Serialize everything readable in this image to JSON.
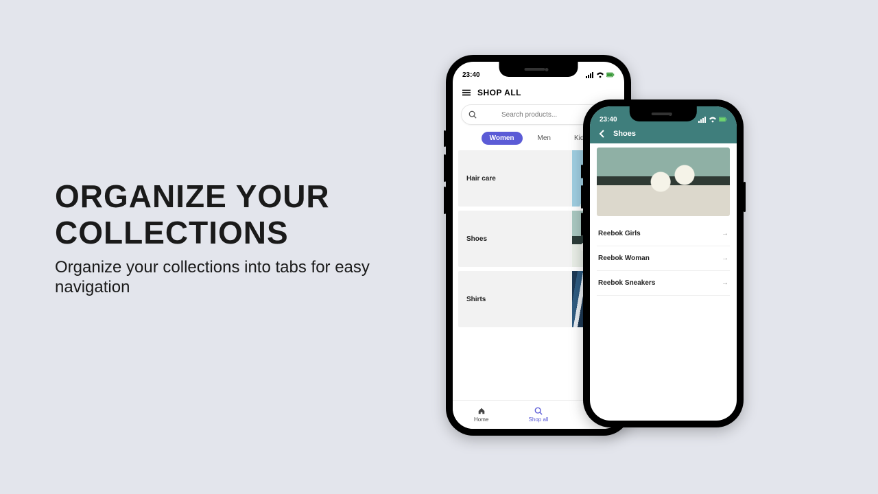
{
  "headline": "ORGANIZE YOUR COLLECTIONS",
  "subhead": "Organize your collections into tabs for easy navigation",
  "phoneA": {
    "status_time": "23:40",
    "header_title": "SHOP ALL",
    "search_placeholder": "Search products...",
    "tabs": {
      "active": "Women",
      "t2": "Men",
      "t3": "Kids"
    },
    "cards": {
      "c1": "Hair care",
      "c2": "Shoes",
      "c3": "Shirts"
    },
    "bottom": {
      "home": "Home",
      "shop": "Shop all"
    }
  },
  "phoneB": {
    "status_time": "23:40",
    "header_title": "Shoes",
    "rows": {
      "r1": "Reebok Girls",
      "r2": "Reebok Woman",
      "r3": "Reebok Sneakers"
    }
  }
}
